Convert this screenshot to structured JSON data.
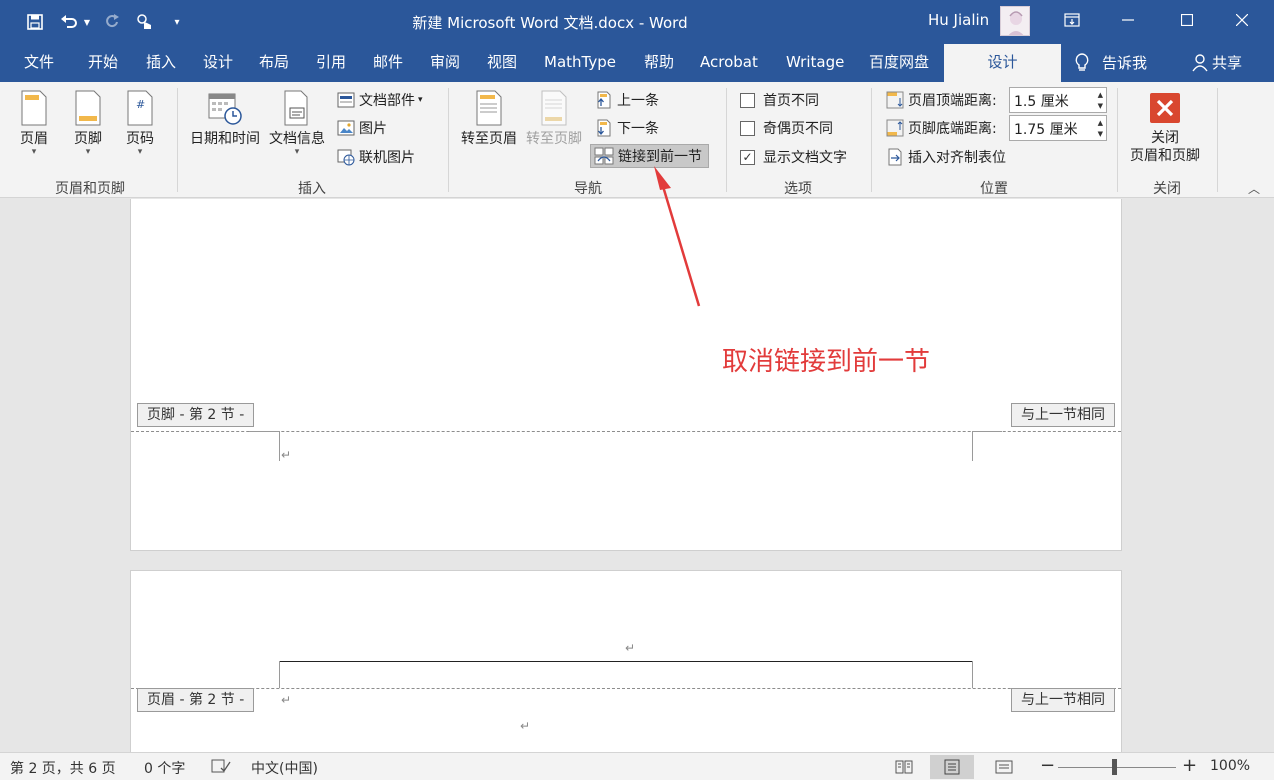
{
  "window": {
    "title": "新建 Microsoft Word 文档.docx  -  Word",
    "user": "Hu Jialin",
    "qat_icons": [
      "save-icon",
      "undo-icon",
      "redo-icon",
      "touch-mode-icon",
      "customize-qat-icon"
    ]
  },
  "tabs": [
    {
      "label": "文件"
    },
    {
      "label": "开始"
    },
    {
      "label": "插入"
    },
    {
      "label": "设计"
    },
    {
      "label": "布局"
    },
    {
      "label": "引用"
    },
    {
      "label": "邮件"
    },
    {
      "label": "审阅"
    },
    {
      "label": "视图"
    },
    {
      "label": "MathType"
    },
    {
      "label": "帮助"
    },
    {
      "label": "Acrobat"
    },
    {
      "label": "Writage"
    },
    {
      "label": "百度网盘"
    },
    {
      "label": "设计",
      "active": true
    },
    {
      "label": "告诉我"
    },
    {
      "label": "共享"
    }
  ],
  "ribbon": {
    "header_footer": {
      "group_label": "页眉和页脚",
      "header": "页眉",
      "footer": "页脚",
      "page_number": "页码"
    },
    "insert": {
      "group_label": "插入",
      "date_time": "日期和时间",
      "doc_info": "文档信息",
      "doc_parts": "文档部件",
      "picture": "图片",
      "online_picture": "联机图片"
    },
    "navigation": {
      "group_label": "导航",
      "goto_header": "转至页眉",
      "goto_footer": "转至页脚",
      "previous": "上一条",
      "next": "下一条",
      "link_to_previous": "链接到前一节"
    },
    "options": {
      "group_label": "选项",
      "different_first_page": "首页不同",
      "different_odd_even": "奇偶页不同",
      "show_doc_text": "显示文档文字",
      "different_first_page_checked": false,
      "different_odd_even_checked": false,
      "show_doc_text_checked": true
    },
    "position": {
      "group_label": "位置",
      "header_from_top_label": "页眉顶端距离:",
      "header_from_top_value": "1.5 厘米",
      "footer_from_bottom_label": "页脚底端距离:",
      "footer_from_bottom_value": "1.75 厘米",
      "insert_alignment_tab": "插入对齐制表位"
    },
    "close": {
      "group_label": "关闭",
      "close_line1": "关闭",
      "close_line2": "页眉和页脚"
    }
  },
  "document": {
    "footer_tag": "页脚 - 第 2 节 -",
    "same_as_previous_1": "与上一节相同",
    "header_tag": "页眉 - 第 2 节 -",
    "same_as_previous_2": "与上一节相同",
    "paragraph_mark": "↵"
  },
  "annotation": {
    "text": "取消链接到前一节",
    "color": "#e23b3b"
  },
  "statusbar": {
    "page_info": "第 2 页，共 6 页",
    "word_count": "0 个字",
    "language": "中文(中国)",
    "zoom": "100%",
    "zoom_minus": "−",
    "zoom_plus": "+"
  },
  "colors": {
    "brand": "#2b579a",
    "ribbon_bg": "#f3f3f3",
    "close_red": "#d9472f"
  }
}
